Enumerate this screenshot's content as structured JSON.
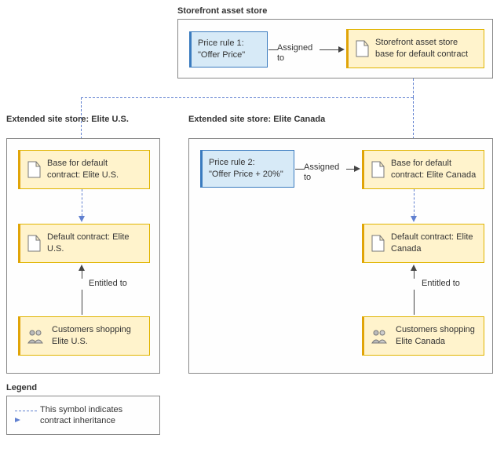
{
  "stores": {
    "asset": {
      "title": "Storefront asset store",
      "price_rule": {
        "line1": "Price rule 1:",
        "line2": "\"Offer Price\""
      },
      "assigned_label": "Assigned to",
      "contract": "Storefront asset store base for default contract"
    },
    "us": {
      "title": "Extended site store: Elite U.S.",
      "base": "Base for default contract: Elite U.S.",
      "default": "Default contract: Elite U.S.",
      "entitled_label": "Entitled to",
      "customers": "Customers shopping Elite U.S."
    },
    "canada": {
      "title": "Extended site store: Elite Canada",
      "price_rule": {
        "line1": "Price rule 2:",
        "line2": "\"Offer Price + 20%\""
      },
      "assigned_label": "Assigned to",
      "base": "Base for default contract: Elite Canada",
      "default": "Default contract: Elite Canada",
      "entitled_label": "Entitled to",
      "customers": "Customers shopping Elite Canada"
    }
  },
  "legend": {
    "title": "Legend",
    "text": "This symbol indicates contract inheritance"
  }
}
